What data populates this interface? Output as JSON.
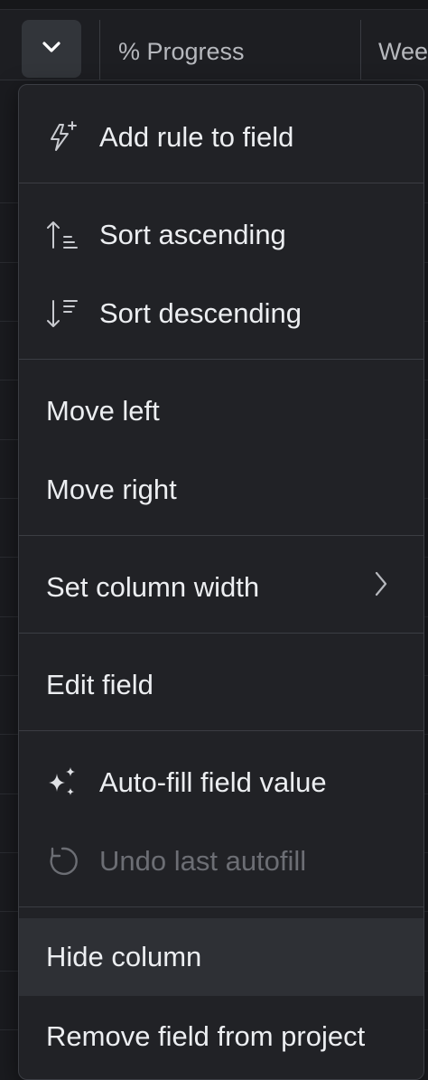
{
  "header": {
    "columns": [
      {
        "title": "% Progress"
      },
      {
        "title": "Wee"
      }
    ]
  },
  "menu": {
    "add_rule": "Add rule to field",
    "sort_ascending": "Sort ascending",
    "sort_descending": "Sort descending",
    "move_left": "Move left",
    "move_right": "Move right",
    "set_column_width": "Set column width",
    "edit_field": "Edit field",
    "auto_fill": "Auto-fill field value",
    "undo_autofill": "Undo last autofill",
    "hide_column": "Hide column",
    "remove_field": "Remove field from project"
  },
  "icons": {
    "header_button": "chevron-down-icon",
    "add_rule": "lightning-sparkle-icon",
    "sort_ascending": "sort-ascending-icon",
    "sort_descending": "sort-descending-icon",
    "set_column_width": "chevron-right-icon",
    "auto_fill": "sparkles-icon",
    "undo_autofill": "undo-icon"
  },
  "colors": {
    "background": "#1a1b1f",
    "menu_bg": "#212226",
    "hover_bg": "#2e3035",
    "text": "#eceef1",
    "disabled_text": "#6c6e74"
  }
}
